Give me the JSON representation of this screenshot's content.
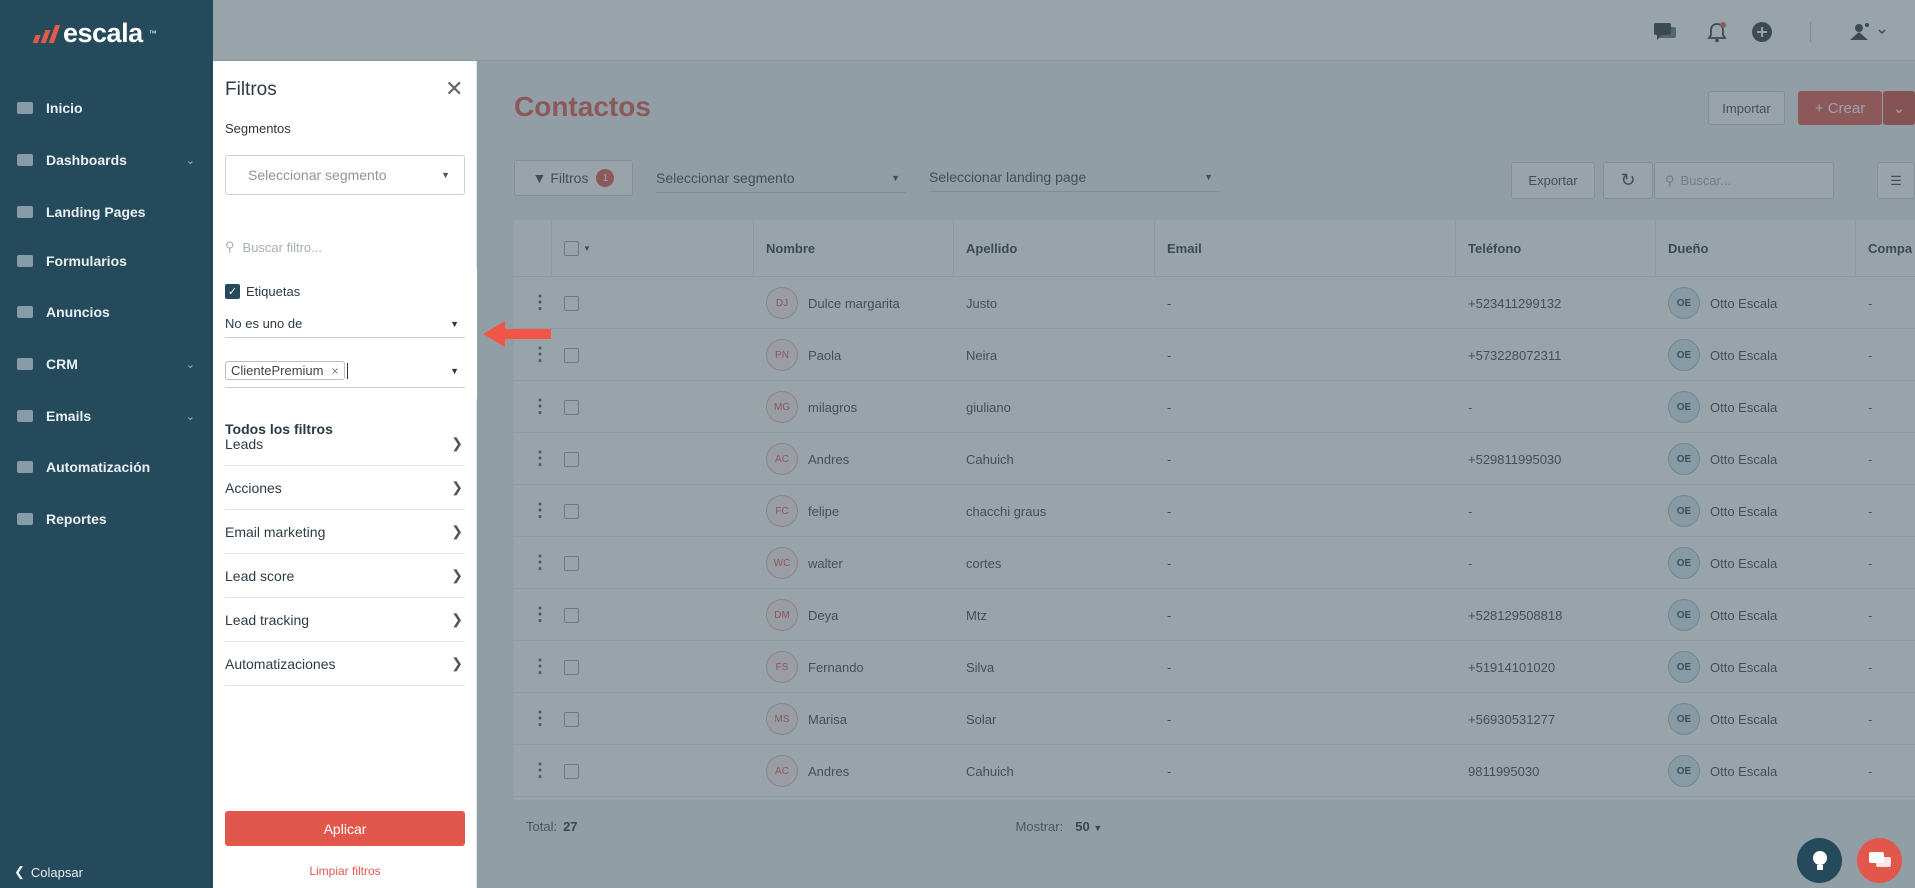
{
  "brand": {
    "name": "escala",
    "tm": "™"
  },
  "sidebar": {
    "items": [
      {
        "label": "Inicio",
        "icon": "home-icon",
        "chevron": false
      },
      {
        "label": "Dashboards",
        "icon": "pie-chart-icon",
        "chevron": true
      },
      {
        "label": "Landing Pages",
        "icon": "landing-page-icon",
        "chevron": false
      },
      {
        "label": "Formularios",
        "icon": "form-icon",
        "chevron": false
      },
      {
        "label": "Anuncios",
        "icon": "ads-icon",
        "chevron": false
      },
      {
        "label": "CRM",
        "icon": "users-icon",
        "chevron": true
      },
      {
        "label": "Emails",
        "icon": "mail-icon",
        "chevron": true
      },
      {
        "label": "Automatización",
        "icon": "bolt-icon",
        "chevron": false
      },
      {
        "label": "Reportes",
        "icon": "report-icon",
        "chevron": false
      }
    ],
    "collapse_label": "Colapsar"
  },
  "filters": {
    "title": "Filtros",
    "segments_label": "Segmentos",
    "segment_placeholder": "Seleccionar segmento",
    "search_placeholder": "Buscar filtro...",
    "active": {
      "field_label": "Etiquetas",
      "checked": true,
      "operator": "No es uno de",
      "tags": [
        "ClientePremium"
      ],
      "tag_remove": "×"
    },
    "all_filters_label": "Todos los filtros",
    "groups": [
      "Leads",
      "Acciones",
      "Email marketing",
      "Lead score",
      "Lead tracking",
      "Automatizaciones"
    ],
    "apply_label": "Aplicar",
    "clear_label": "Limpiar filtros"
  },
  "main": {
    "title": "Contactos",
    "import_label": "Importar",
    "create_label": "+ Crear",
    "filters_button": "Filtros",
    "filters_count": "1",
    "segment_select": "Seleccionar segmento",
    "landing_select": "Seleccionar landing page",
    "export_label": "Exportar",
    "search_placeholder": "Buscar...",
    "columns": [
      "Nombre",
      "Apellido",
      "Email",
      "Teléfono",
      "Dueño",
      "Compa"
    ],
    "rows": [
      {
        "initials": "DJ",
        "nombre": "Dulce margarita",
        "apellido": "Justo",
        "email": "-",
        "telefono": "+523411299132",
        "owner_initials": "OE",
        "owner": "Otto Escala",
        "company": "-"
      },
      {
        "initials": "PN",
        "nombre": "Paola",
        "apellido": "Neira",
        "email": "-",
        "telefono": "+573228072311",
        "owner_initials": "OE",
        "owner": "Otto Escala",
        "company": "-"
      },
      {
        "initials": "MG",
        "nombre": "milagros",
        "apellido": "giuliano",
        "email": "-",
        "telefono": "-",
        "owner_initials": "OE",
        "owner": "Otto Escala",
        "company": "-"
      },
      {
        "initials": "AC",
        "nombre": "Andres",
        "apellido": "Cahuich",
        "email": "-",
        "telefono": "+529811995030",
        "owner_initials": "OE",
        "owner": "Otto Escala",
        "company": "-"
      },
      {
        "initials": "FC",
        "nombre": "felipe",
        "apellido": "chacchi graus",
        "email": "-",
        "telefono": "-",
        "owner_initials": "OE",
        "owner": "Otto Escala",
        "company": "-"
      },
      {
        "initials": "WC",
        "nombre": "walter",
        "apellido": "cortes",
        "email": "-",
        "telefono": "-",
        "owner_initials": "OE",
        "owner": "Otto Escala",
        "company": "-"
      },
      {
        "initials": "DM",
        "nombre": "Deya",
        "apellido": "Mtz",
        "email": "-",
        "telefono": "+528129508818",
        "owner_initials": "OE",
        "owner": "Otto Escala",
        "company": "-"
      },
      {
        "initials": "FS",
        "nombre": "Fernando",
        "apellido": "Silva",
        "email": "-",
        "telefono": "+51914101020",
        "owner_initials": "OE",
        "owner": "Otto Escala",
        "company": "-"
      },
      {
        "initials": "MS",
        "nombre": "Marisa",
        "apellido": "Solar",
        "email": "-",
        "telefono": "+56930531277",
        "owner_initials": "OE",
        "owner": "Otto Escala",
        "company": "-"
      },
      {
        "initials": "AC",
        "nombre": "Andres",
        "apellido": "Cahuich",
        "email": "-",
        "telefono": "9811995030",
        "owner_initials": "OE",
        "owner": "Otto Escala",
        "company": "-"
      }
    ],
    "total_label": "Total:",
    "total_value": "27",
    "show_label": "Mostrar:",
    "show_value": "50"
  },
  "colors": {
    "brand_red": "#e2574c",
    "sidebar": "#244a5c",
    "annotation_arrow": "#f05545"
  }
}
